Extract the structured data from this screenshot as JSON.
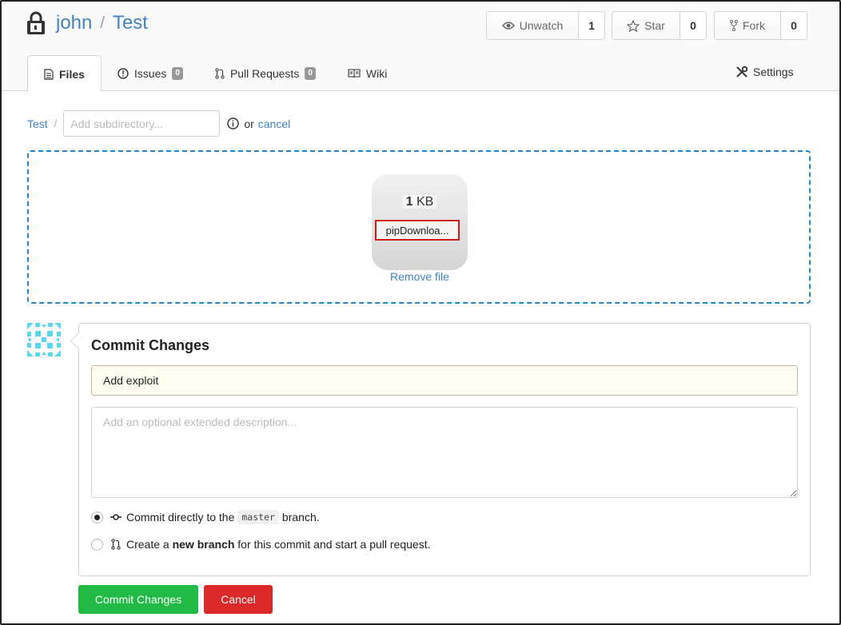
{
  "repo": {
    "owner": "john",
    "separator": "/",
    "name": "Test"
  },
  "header_buttons": {
    "watch": {
      "label": "Unwatch",
      "count": "1"
    },
    "star": {
      "label": "Star",
      "count": "0"
    },
    "fork": {
      "label": "Fork",
      "count": "0"
    }
  },
  "tabs": [
    {
      "label": "Files",
      "active": true
    },
    {
      "label": "Issues",
      "badge": "0"
    },
    {
      "label": "Pull Requests",
      "badge": "0"
    },
    {
      "label": "Wiki"
    }
  ],
  "settings_label": "Settings",
  "path": {
    "root": "Test",
    "separator": "/",
    "subdir_placeholder": "Add subdirectory...",
    "or_text": "or",
    "cancel_label": "cancel"
  },
  "upload": {
    "file_size_value": "1",
    "file_size_unit": "KB",
    "file_name": "pipDownloa...",
    "remove_label": "Remove file"
  },
  "commit": {
    "title": "Commit Changes",
    "summary_value": "Add exploit",
    "description_placeholder": "Add an optional extended description...",
    "option_direct": {
      "prefix": "Commit directly to the",
      "branch": "master",
      "suffix": "branch.",
      "checked": true
    },
    "option_new": {
      "prefix": "Create a",
      "bold": "new branch",
      "suffix": "for this commit and start a pull request.",
      "checked": false
    },
    "submit_label": "Commit Changes",
    "cancel_label": "Cancel"
  },
  "colors": {
    "link": "#4183c4",
    "dropzone_border": "#2185d0",
    "commit_green": "#21ba45",
    "cancel_red": "#db2828",
    "file_highlight": "#d01919"
  }
}
